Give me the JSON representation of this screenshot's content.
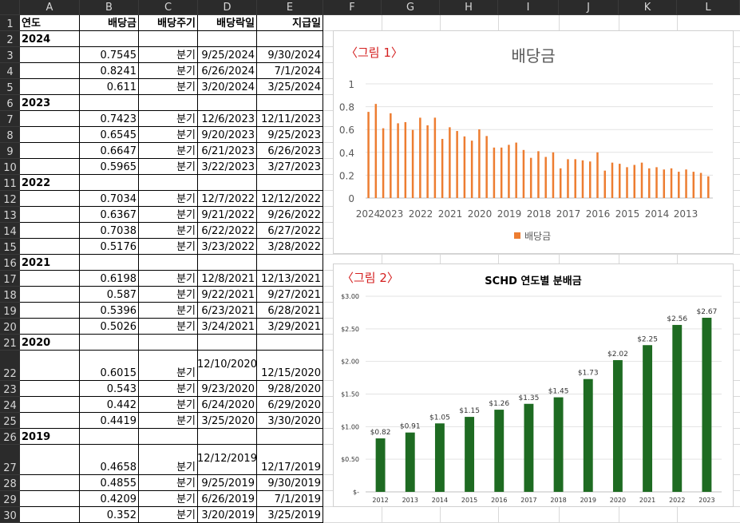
{
  "columns": [
    "A",
    "B",
    "C",
    "D",
    "E",
    "F",
    "G",
    "H",
    "I",
    "J",
    "K",
    "L"
  ],
  "header_row": {
    "year": "연도",
    "dividend": "배당금",
    "cycle": "배당주기",
    "ex_date": "배당락일",
    "pay_date": "지급일"
  },
  "rows": [
    {
      "num": "2",
      "year": "2024"
    },
    {
      "num": "3",
      "dividend": "0.7545",
      "cycle": "분기",
      "ex_date": "9/25/2024",
      "pay_date": "9/30/2024"
    },
    {
      "num": "4",
      "dividend": "0.8241",
      "cycle": "분기",
      "ex_date": "6/26/2024",
      "pay_date": "7/1/2024"
    },
    {
      "num": "5",
      "dividend": "0.611",
      "cycle": "분기",
      "ex_date": "3/20/2024",
      "pay_date": "3/25/2024"
    },
    {
      "num": "6",
      "year": "2023"
    },
    {
      "num": "7",
      "dividend": "0.7423",
      "cycle": "분기",
      "ex_date": "12/6/2023",
      "pay_date": "12/11/2023"
    },
    {
      "num": "8",
      "dividend": "0.6545",
      "cycle": "분기",
      "ex_date": "9/20/2023",
      "pay_date": "9/25/2023"
    },
    {
      "num": "9",
      "dividend": "0.6647",
      "cycle": "분기",
      "ex_date": "6/21/2023",
      "pay_date": "6/26/2023"
    },
    {
      "num": "10",
      "dividend": "0.5965",
      "cycle": "분기",
      "ex_date": "3/22/2023",
      "pay_date": "3/27/2023"
    },
    {
      "num": "11",
      "year": "2022"
    },
    {
      "num": "12",
      "dividend": "0.7034",
      "cycle": "분기",
      "ex_date": "12/7/2022",
      "pay_date": "12/12/2022"
    },
    {
      "num": "13",
      "dividend": "0.6367",
      "cycle": "분기",
      "ex_date": "9/21/2022",
      "pay_date": "9/26/2022"
    },
    {
      "num": "14",
      "dividend": "0.7038",
      "cycle": "분기",
      "ex_date": "6/22/2022",
      "pay_date": "6/27/2022"
    },
    {
      "num": "15",
      "dividend": "0.5176",
      "cycle": "분기",
      "ex_date": "3/23/2022",
      "pay_date": "3/28/2022"
    },
    {
      "num": "16",
      "year": "2021"
    },
    {
      "num": "17",
      "dividend": "0.6198",
      "cycle": "분기",
      "ex_date": "12/8/2021",
      "pay_date": "12/13/2021"
    },
    {
      "num": "18",
      "dividend": "0.587",
      "cycle": "분기",
      "ex_date": "9/22/2021",
      "pay_date": "9/27/2021"
    },
    {
      "num": "19",
      "dividend": "0.5396",
      "cycle": "분기",
      "ex_date": "6/23/2021",
      "pay_date": "6/28/2021"
    },
    {
      "num": "20",
      "dividend": "0.5026",
      "cycle": "분기",
      "ex_date": "3/24/2021",
      "pay_date": "3/29/2021"
    },
    {
      "num": "21",
      "year": "2020"
    },
    {
      "num": "22",
      "dividend": "0.6015",
      "cycle": "분기",
      "ex_date": "12/10/2020",
      "pay_date": "12/15/2020",
      "tall": true
    },
    {
      "num": "23",
      "dividend": "0.543",
      "cycle": "분기",
      "ex_date": "9/23/2020",
      "pay_date": "9/28/2020"
    },
    {
      "num": "24",
      "dividend": "0.442",
      "cycle": "분기",
      "ex_date": "6/24/2020",
      "pay_date": "6/29/2020"
    },
    {
      "num": "25",
      "dividend": "0.4419",
      "cycle": "분기",
      "ex_date": "3/25/2020",
      "pay_date": "3/30/2020"
    },
    {
      "num": "26",
      "year": "2019"
    },
    {
      "num": "27",
      "dividend": "0.4658",
      "cycle": "분기",
      "ex_date": "12/12/2019",
      "pay_date": "12/17/2019",
      "tall": true
    },
    {
      "num": "28",
      "dividend": "0.4855",
      "cycle": "분기",
      "ex_date": "9/25/2019",
      "pay_date": "9/30/2019"
    },
    {
      "num": "29",
      "dividend": "0.4209",
      "cycle": "분기",
      "ex_date": "6/26/2019",
      "pay_date": "7/1/2019"
    },
    {
      "num": "30",
      "dividend": "0.352",
      "cycle": "분기",
      "ex_date": "3/20/2019",
      "pay_date": "3/25/2019"
    }
  ],
  "chart_data": [
    {
      "type": "bar",
      "label": "〈그림 1〉",
      "title": "배당금",
      "legend": "배당금",
      "legend_position": "bottom",
      "color": "#ed7d31",
      "ylim": [
        0,
        1
      ],
      "yticks": [
        "0",
        "0.2",
        "0.4",
        "0.6",
        "0.8",
        "1"
      ],
      "xticks": [
        "2024",
        "2023",
        "2022",
        "2021",
        "2020",
        "2019",
        "2018",
        "2017",
        "2016",
        "2015",
        "2014",
        "2013"
      ],
      "values": [
        0.7545,
        0.8241,
        0.611,
        0.7423,
        0.6545,
        0.6647,
        0.5965,
        0.7034,
        0.6367,
        0.7038,
        0.5176,
        0.6198,
        0.587,
        0.5396,
        0.5026,
        0.6015,
        0.543,
        0.442,
        0.4419,
        0.4658,
        0.4855,
        0.4209,
        0.352,
        0.41,
        0.36,
        0.4,
        0.26,
        0.34,
        0.34,
        0.33,
        0.32,
        0.4,
        0.24,
        0.31,
        0.3,
        0.27,
        0.29,
        0.31,
        0.26,
        0.27,
        0.25,
        0.26,
        0.23,
        0.25,
        0.23,
        0.22,
        0.19
      ],
      "grid": true
    },
    {
      "type": "bar",
      "label": "〈그림 2〉",
      "title": "SCHD 연도별 분배금",
      "color": "#1e6b22",
      "categories": [
        "2012",
        "2013",
        "2014",
        "2015",
        "2016",
        "2017",
        "2018",
        "2019",
        "2020",
        "2021",
        "2022",
        "2023"
      ],
      "values": [
        0.82,
        0.91,
        1.05,
        1.15,
        1.26,
        1.35,
        1.45,
        1.73,
        2.02,
        2.25,
        2.56,
        2.67
      ],
      "data_labels": [
        "$0.82",
        "$0.91",
        "$1.05",
        "$1.15",
        "$1.26",
        "$1.35",
        "$1.45",
        "$1.73",
        "$2.02",
        "$2.25",
        "$2.56",
        "$2.67"
      ],
      "ylim": [
        0,
        3
      ],
      "yticks": [
        "$-",
        "$0.50",
        "$1.00",
        "$1.50",
        "$2.00",
        "$2.50",
        "$3.00"
      ],
      "grid": true
    }
  ]
}
